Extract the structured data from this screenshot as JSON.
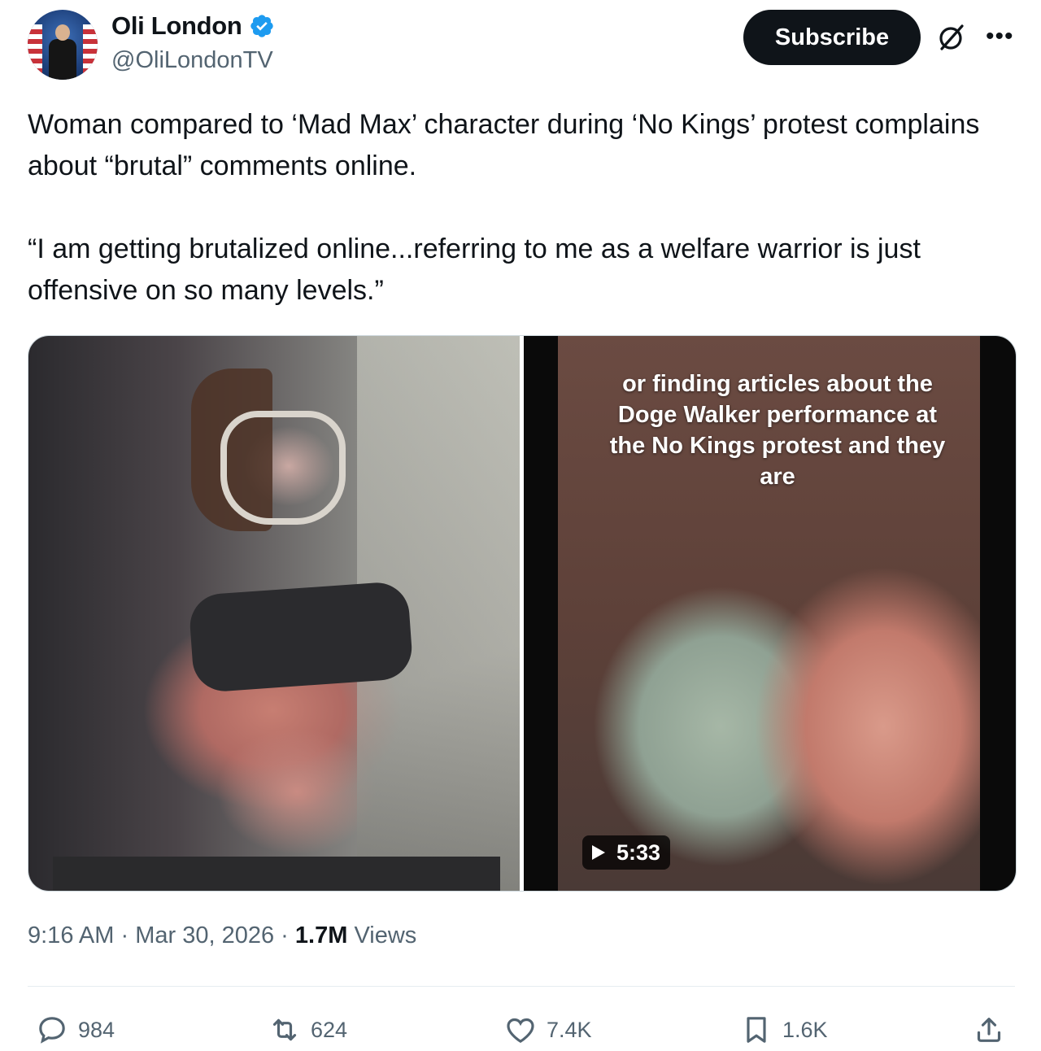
{
  "author": {
    "name": "Oli London",
    "handle": "@OliLondonTV"
  },
  "header": {
    "subscribe_label": "Subscribe"
  },
  "tweet": {
    "paragraphs": [
      "Woman compared to ‘Mad Max’ character during ‘No Kings’ protest complains about “brutal” comments online.",
      "“I am getting brutalized online...referring to me as a welfare warrior is just offensive on so many levels.”"
    ]
  },
  "media": {
    "video_caption": "or finding articles about the Doge Walker performance at the No Kings protest and they are",
    "video_duration": "5:33"
  },
  "meta": {
    "time": "9:16 AM",
    "date": "Mar 30, 2026",
    "separator": "·",
    "views_count": "1.7M",
    "views_label": "Views"
  },
  "actions": {
    "replies": "984",
    "reposts": "624",
    "likes": "7.4K",
    "bookmarks": "1.6K"
  },
  "colors": {
    "verified": "#1d9bf0",
    "text": "#0f1419",
    "secondary": "#536471"
  }
}
